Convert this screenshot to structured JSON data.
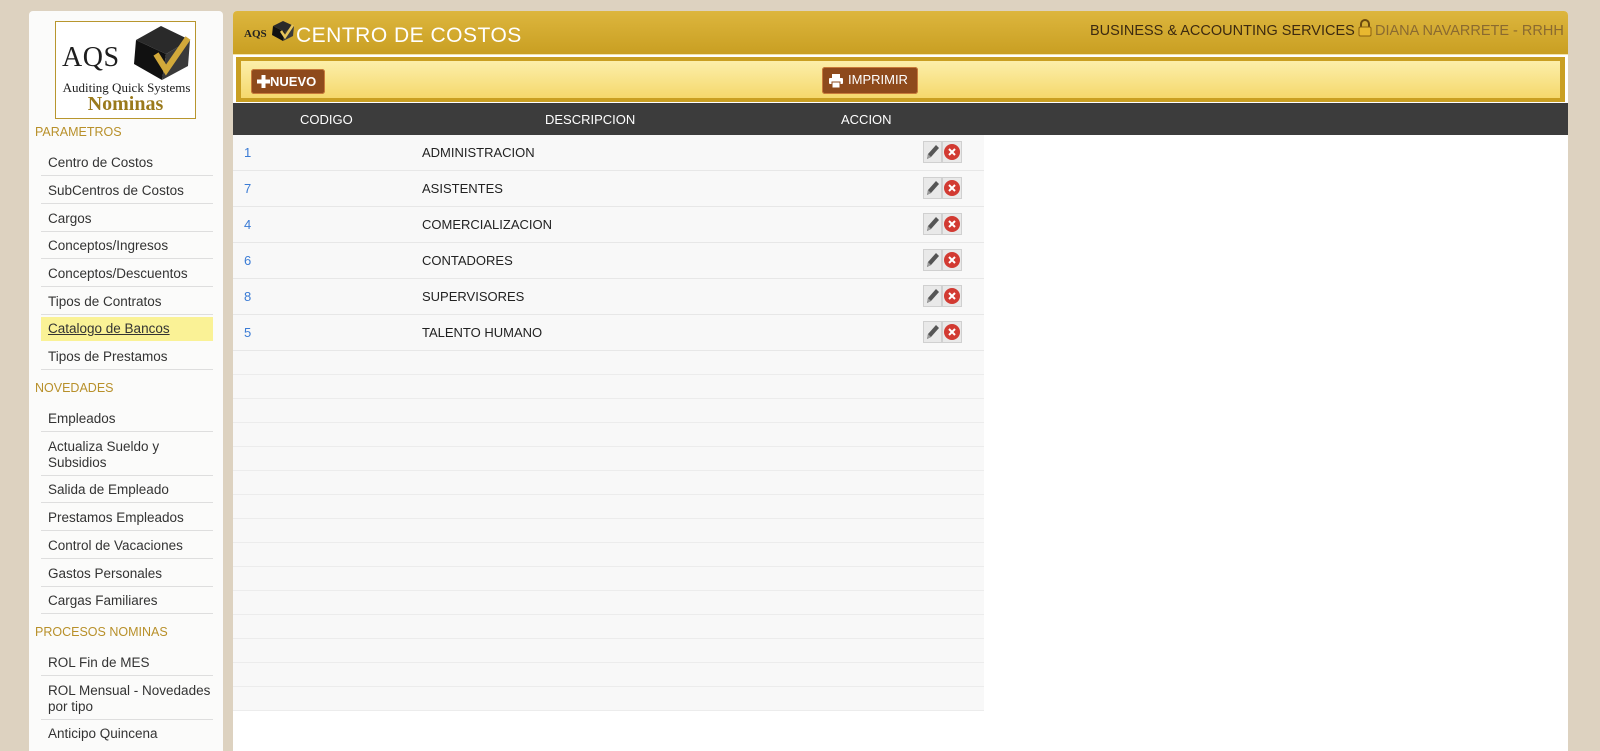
{
  "logo": {
    "main": "AQS",
    "subtitle": "Auditing Quick Systems",
    "product": "Nominas"
  },
  "sidebar": {
    "sections": [
      {
        "title": "PARAMETROS",
        "items": [
          {
            "label": "Centro de Costos"
          },
          {
            "label": "SubCentros de Costos"
          },
          {
            "label": "Cargos"
          },
          {
            "label": "Conceptos/Ingresos"
          },
          {
            "label": "Conceptos/Descuentos"
          },
          {
            "label": "Tipos de Contratos"
          },
          {
            "label": "Catalogo de Bancos",
            "active": true
          },
          {
            "label": "Tipos de Prestamos"
          }
        ]
      },
      {
        "title": "NOVEDADES",
        "items": [
          {
            "label": "Empleados"
          },
          {
            "label": "Actualiza Sueldo y Subsidios"
          },
          {
            "label": "Salida de Empleado"
          },
          {
            "label": "Prestamos Empleados"
          },
          {
            "label": "Control de Vacaciones"
          },
          {
            "label": "Gastos Personales"
          },
          {
            "label": "Cargas Familiares"
          }
        ]
      },
      {
        "title": "PROCESOS NOMINAS",
        "items": [
          {
            "label": "ROL Fin de MES"
          },
          {
            "label": "ROL Mensual - Novedades por tipo"
          },
          {
            "label": "Anticipo Quincena"
          }
        ]
      }
    ]
  },
  "header": {
    "logo_text": "AQS",
    "title": "CENTRO DE COSTOS",
    "company": "BUSINESS & ACCOUNTING SERVICES",
    "user": "DIANA NAVARRETE - RRHH"
  },
  "toolbar": {
    "new_label": "NUEVO",
    "print_label": "IMPRIMIR"
  },
  "table": {
    "columns": [
      "CODIGO",
      "DESCRIPCION",
      "ACCION"
    ],
    "rows": [
      {
        "code": "1",
        "description": "ADMINISTRACION"
      },
      {
        "code": "7",
        "description": "ASISTENTES"
      },
      {
        "code": "4",
        "description": "COMERCIALIZACION"
      },
      {
        "code": "6",
        "description": "CONTADORES"
      },
      {
        "code": "8",
        "description": "SUPERVISORES"
      },
      {
        "code": "5",
        "description": "TALENTO HUMANO"
      }
    ]
  },
  "colors": {
    "header_gold": "#d4ac2e",
    "button_brown": "#8e4a1c",
    "grid_header": "#3c3c3c",
    "link_blue": "#3a7bd5",
    "active_item": "#faf296"
  },
  "icons": [
    "cube-logo-icon",
    "plus-icon",
    "printer-icon",
    "lock-icon",
    "pencil-edit-icon",
    "delete-x-icon"
  ]
}
